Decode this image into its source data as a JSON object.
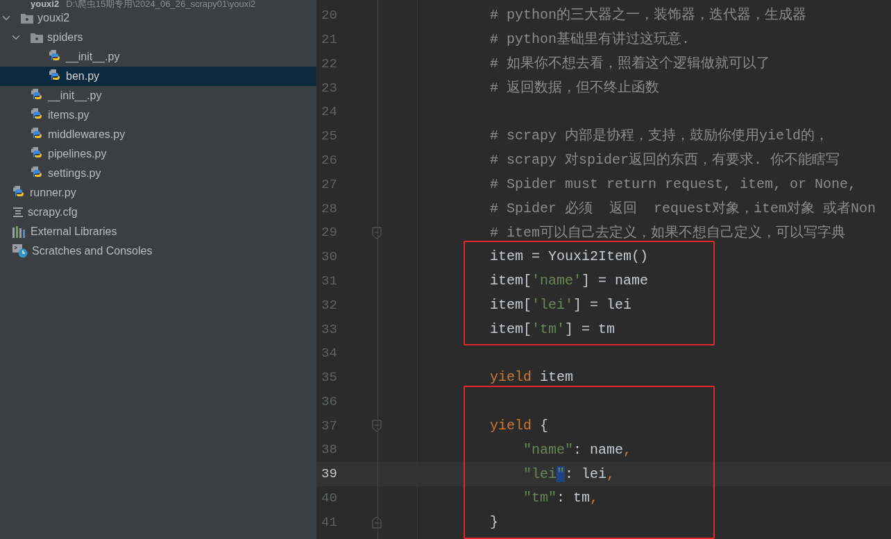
{
  "project_tree": [
    {
      "label": "youxi2",
      "path": "D:\\爬虫15期专用\\2024_06_26_scrapy01\\youxi2",
      "children": [
        {
          "kind": "folder",
          "label": "youxi2",
          "expanded": true,
          "selected": false,
          "children": [
            {
              "kind": "folder",
              "label": "spiders",
              "expanded": true,
              "selected": false,
              "children": [
                {
                  "kind": "python",
                  "label": "__init__.py",
                  "selected": false
                },
                {
                  "kind": "python",
                  "label": "ben.py",
                  "selected": true
                }
              ]
            },
            {
              "kind": "python",
              "label": "__init__.py",
              "selected": false
            },
            {
              "kind": "python",
              "label": "items.py",
              "selected": false
            },
            {
              "kind": "python",
              "label": "middlewares.py",
              "selected": false
            },
            {
              "kind": "python",
              "label": "pipelines.py",
              "selected": false
            },
            {
              "kind": "python",
              "label": "settings.py",
              "selected": false
            }
          ]
        },
        {
          "kind": "python",
          "label": "runner.py",
          "selected": false
        },
        {
          "kind": "config",
          "label": "scrapy.cfg",
          "selected": false
        }
      ]
    },
    {
      "kind": "libraries",
      "label": "External Libraries",
      "selected": false
    },
    {
      "kind": "scratches",
      "label": "Scratches and Consoles",
      "selected": false
    }
  ],
  "editor": {
    "lines": [
      {
        "number": "20",
        "current": false,
        "boxed": false,
        "fold_start": false,
        "fold_end": false,
        "tokens": [
          {
            "kind": "comment",
            "text": "# python的三大器之一，装饰器，迭代器，生成器"
          }
        ]
      },
      {
        "number": "21",
        "current": false,
        "boxed": false,
        "fold_start": false,
        "fold_end": false,
        "tokens": [
          {
            "kind": "comment",
            "text": "# python基础里有讲过这玩意."
          }
        ]
      },
      {
        "number": "22",
        "current": false,
        "boxed": false,
        "fold_start": false,
        "fold_end": false,
        "tokens": [
          {
            "kind": "comment",
            "text": "# 如果你不想去看，照着这个逻辑做就可以了"
          }
        ]
      },
      {
        "number": "23",
        "current": false,
        "boxed": false,
        "fold_start": false,
        "fold_end": false,
        "tokens": [
          {
            "kind": "comment",
            "text": "# 返回数据，但不终止函数"
          }
        ]
      },
      {
        "number": "24",
        "current": false,
        "boxed": false,
        "fold_start": false,
        "fold_end": false
      },
      {
        "number": "25",
        "current": false,
        "boxed": false,
        "fold_start": false,
        "fold_end": false,
        "tokens": [
          {
            "kind": "comment",
            "text": "# scrapy 内部是协程，支持，鼓励你使用yield的，"
          }
        ]
      },
      {
        "number": "26",
        "current": false,
        "boxed": false,
        "fold_start": false,
        "fold_end": false,
        "tokens": [
          {
            "kind": "comment",
            "text": "# scrapy 对spider返回的东西，有要求. 你不能瞎写"
          }
        ]
      },
      {
        "number": "27",
        "current": false,
        "boxed": false,
        "fold_start": false,
        "fold_end": false,
        "tokens": [
          {
            "kind": "comment",
            "text": "# Spider must return request, item, or None,"
          }
        ]
      },
      {
        "number": "28",
        "current": false,
        "boxed": false,
        "fold_start": false,
        "fold_end": false,
        "tokens": [
          {
            "kind": "comment",
            "text": "# Spider 必须  返回  request对象，item对象 或者Non"
          }
        ]
      },
      {
        "number": "29",
        "current": false,
        "boxed": false,
        "fold_start": true,
        "fold_end": false,
        "tokens": [
          {
            "kind": "comment",
            "text": "# item可以自己去定义，如果不想自己定义，可以写字典"
          }
        ]
      },
      {
        "number": "30",
        "current": false,
        "boxed": true,
        "fold_start": false,
        "fold_end": false,
        "tokens": [
          {
            "kind": "plain",
            "text": "item = Youxi2Item()"
          }
        ]
      },
      {
        "number": "31",
        "current": false,
        "boxed": true,
        "fold_start": false,
        "fold_end": false,
        "tokens": [
          {
            "kind": "plain",
            "text": "item["
          },
          {
            "kind": "string",
            "text": "'name'"
          },
          {
            "kind": "plain",
            "text": "] = name"
          }
        ]
      },
      {
        "number": "32",
        "current": false,
        "boxed": true,
        "fold_start": false,
        "fold_end": false,
        "tokens": [
          {
            "kind": "plain",
            "text": "item["
          },
          {
            "kind": "string",
            "text": "'lei'"
          },
          {
            "kind": "plain",
            "text": "] = lei"
          }
        ]
      },
      {
        "number": "33",
        "current": false,
        "boxed": true,
        "fold_start": false,
        "fold_end": false,
        "tokens": [
          {
            "kind": "plain",
            "text": "item["
          },
          {
            "kind": "string",
            "text": "'tm'"
          },
          {
            "kind": "plain",
            "text": "] = tm"
          }
        ]
      },
      {
        "number": "34",
        "current": false,
        "boxed": false,
        "fold_start": false,
        "fold_end": false
      },
      {
        "number": "35",
        "current": false,
        "boxed": false,
        "fold_start": false,
        "fold_end": false,
        "tokens": [
          {
            "kind": "keyword",
            "text": "yield"
          },
          {
            "kind": "plain",
            "text": " item"
          }
        ]
      },
      {
        "number": "36",
        "current": false,
        "boxed": true,
        "fold_start": false,
        "fold_end": false
      },
      {
        "number": "37",
        "current": false,
        "boxed": true,
        "fold_start": true,
        "fold_end": false,
        "tokens": [
          {
            "kind": "keyword",
            "text": "yield"
          },
          {
            "kind": "plain",
            "text": " {"
          }
        ]
      },
      {
        "number": "38",
        "current": false,
        "boxed": true,
        "fold_start": false,
        "fold_end": false,
        "tokens": [
          {
            "kind": "string",
            "text": "    \"name\""
          },
          {
            "kind": "plain",
            "text": ": name"
          },
          {
            "kind": "punct",
            "text": ","
          }
        ]
      },
      {
        "number": "39",
        "current": true,
        "boxed": true,
        "fold_start": false,
        "fold_end": false,
        "tokens": [
          {
            "kind": "string",
            "text": "    \"lei"
          },
          {
            "kind": "selection",
            "text": "\""
          },
          {
            "kind": "plain",
            "text": ": lei"
          },
          {
            "kind": "punct",
            "text": ","
          }
        ]
      },
      {
        "number": "40",
        "current": false,
        "boxed": true,
        "fold_start": false,
        "fold_end": false,
        "tokens": [
          {
            "kind": "string",
            "text": "    \"tm\""
          },
          {
            "kind": "plain",
            "text": ": tm"
          },
          {
            "kind": "punct",
            "text": ","
          }
        ]
      },
      {
        "number": "41",
        "current": false,
        "boxed": true,
        "fold_start": false,
        "fold_end": true,
        "tokens": [
          {
            "kind": "plain",
            "text": "}"
          }
        ]
      }
    ]
  }
}
